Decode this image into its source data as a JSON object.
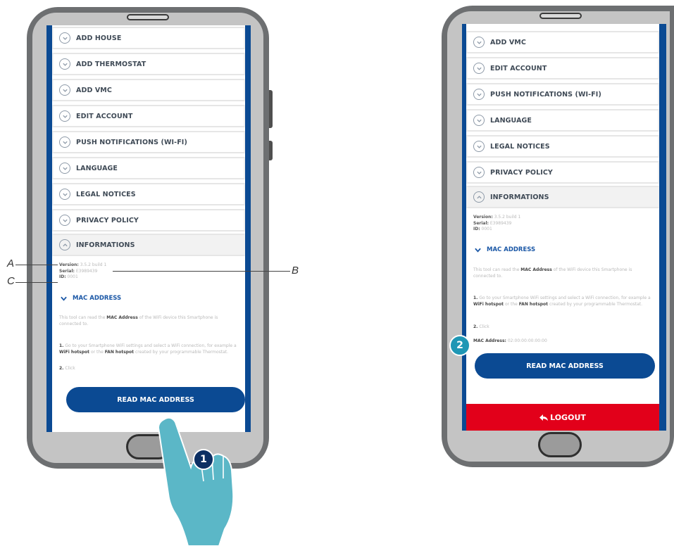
{
  "colors": {
    "brand_blue": "#0b4a93",
    "logout_red": "#e2001a",
    "step1": "#0c2f63",
    "step2": "#1f97b5",
    "hand": "#5bb7c7"
  },
  "left": {
    "menu": [
      "ADD HOUSE",
      "ADD THERMOSTAT",
      "ADD VMC",
      "EDIT ACCOUNT",
      "PUSH NOTIFICATIONS (WI-FI)",
      "LANGUAGE",
      "LEGAL NOTICES",
      "PRIVACY POLICY"
    ],
    "info_title": "INFORMATIONS",
    "version_label": "Version:",
    "version_value": "3.5.2 build 1",
    "serial_label": "Serial:",
    "serial_value": "E3989439",
    "id_label": "ID:",
    "id_value": "0001",
    "mac_title": "MAC ADDRESS",
    "para1_a": "This tool can read the ",
    "para1_b": "MAC Address",
    "para1_c": " of the WiFi device this Smartphone is connected to.",
    "step_1_num": "1.",
    "step_1_a": " Go to your Smartphone WiFi settings and select a WiFi connection, for example a ",
    "step_1_b": "WiFi hotspot",
    "step_1_c": " or the ",
    "step_1_d": "FAN hotspot",
    "step_1_e": " created by your programmable Thermostat.",
    "step_2_num": "2.",
    "step_2_text": " Click",
    "button": "READ MAC ADDRESS"
  },
  "right": {
    "menu": [
      "ADD VMC",
      "EDIT ACCOUNT",
      "PUSH NOTIFICATIONS (WI-FI)",
      "LANGUAGE",
      "LEGAL NOTICES",
      "PRIVACY POLICY"
    ],
    "info_title": "INFORMATIONS",
    "version_label": "Version:",
    "version_value": "3.5.2 build 1",
    "serial_label": "Serial:",
    "serial_value": "E3989439",
    "id_label": "ID:",
    "id_value": "0001",
    "mac_title": "MAC ADDRESS",
    "para1_a": "This tool can read the ",
    "para1_b": "MAC Address",
    "para1_c": " of the WiFi device this Smartphone is connected to.",
    "step_1_num": "1.",
    "step_1_a": " Go to your Smartphone WiFi settings and select a WiFi connection, for example a ",
    "step_1_b": "WiFi hotspot",
    "step_1_c": " or the ",
    "step_1_d": "FAN hotspot",
    "step_1_e": " created by your programmable Thermostat.",
    "step_2_num": "2.",
    "step_2_text": " Click",
    "mac_result_label": "MAC Address:",
    "mac_result_value": "02:00:00:00:00:00",
    "button": "READ MAC ADDRESS",
    "logout": "LOGOUT"
  },
  "callouts": {
    "a": "A",
    "b": "B",
    "c": "C"
  },
  "steps": {
    "one": "1",
    "two": "2"
  }
}
